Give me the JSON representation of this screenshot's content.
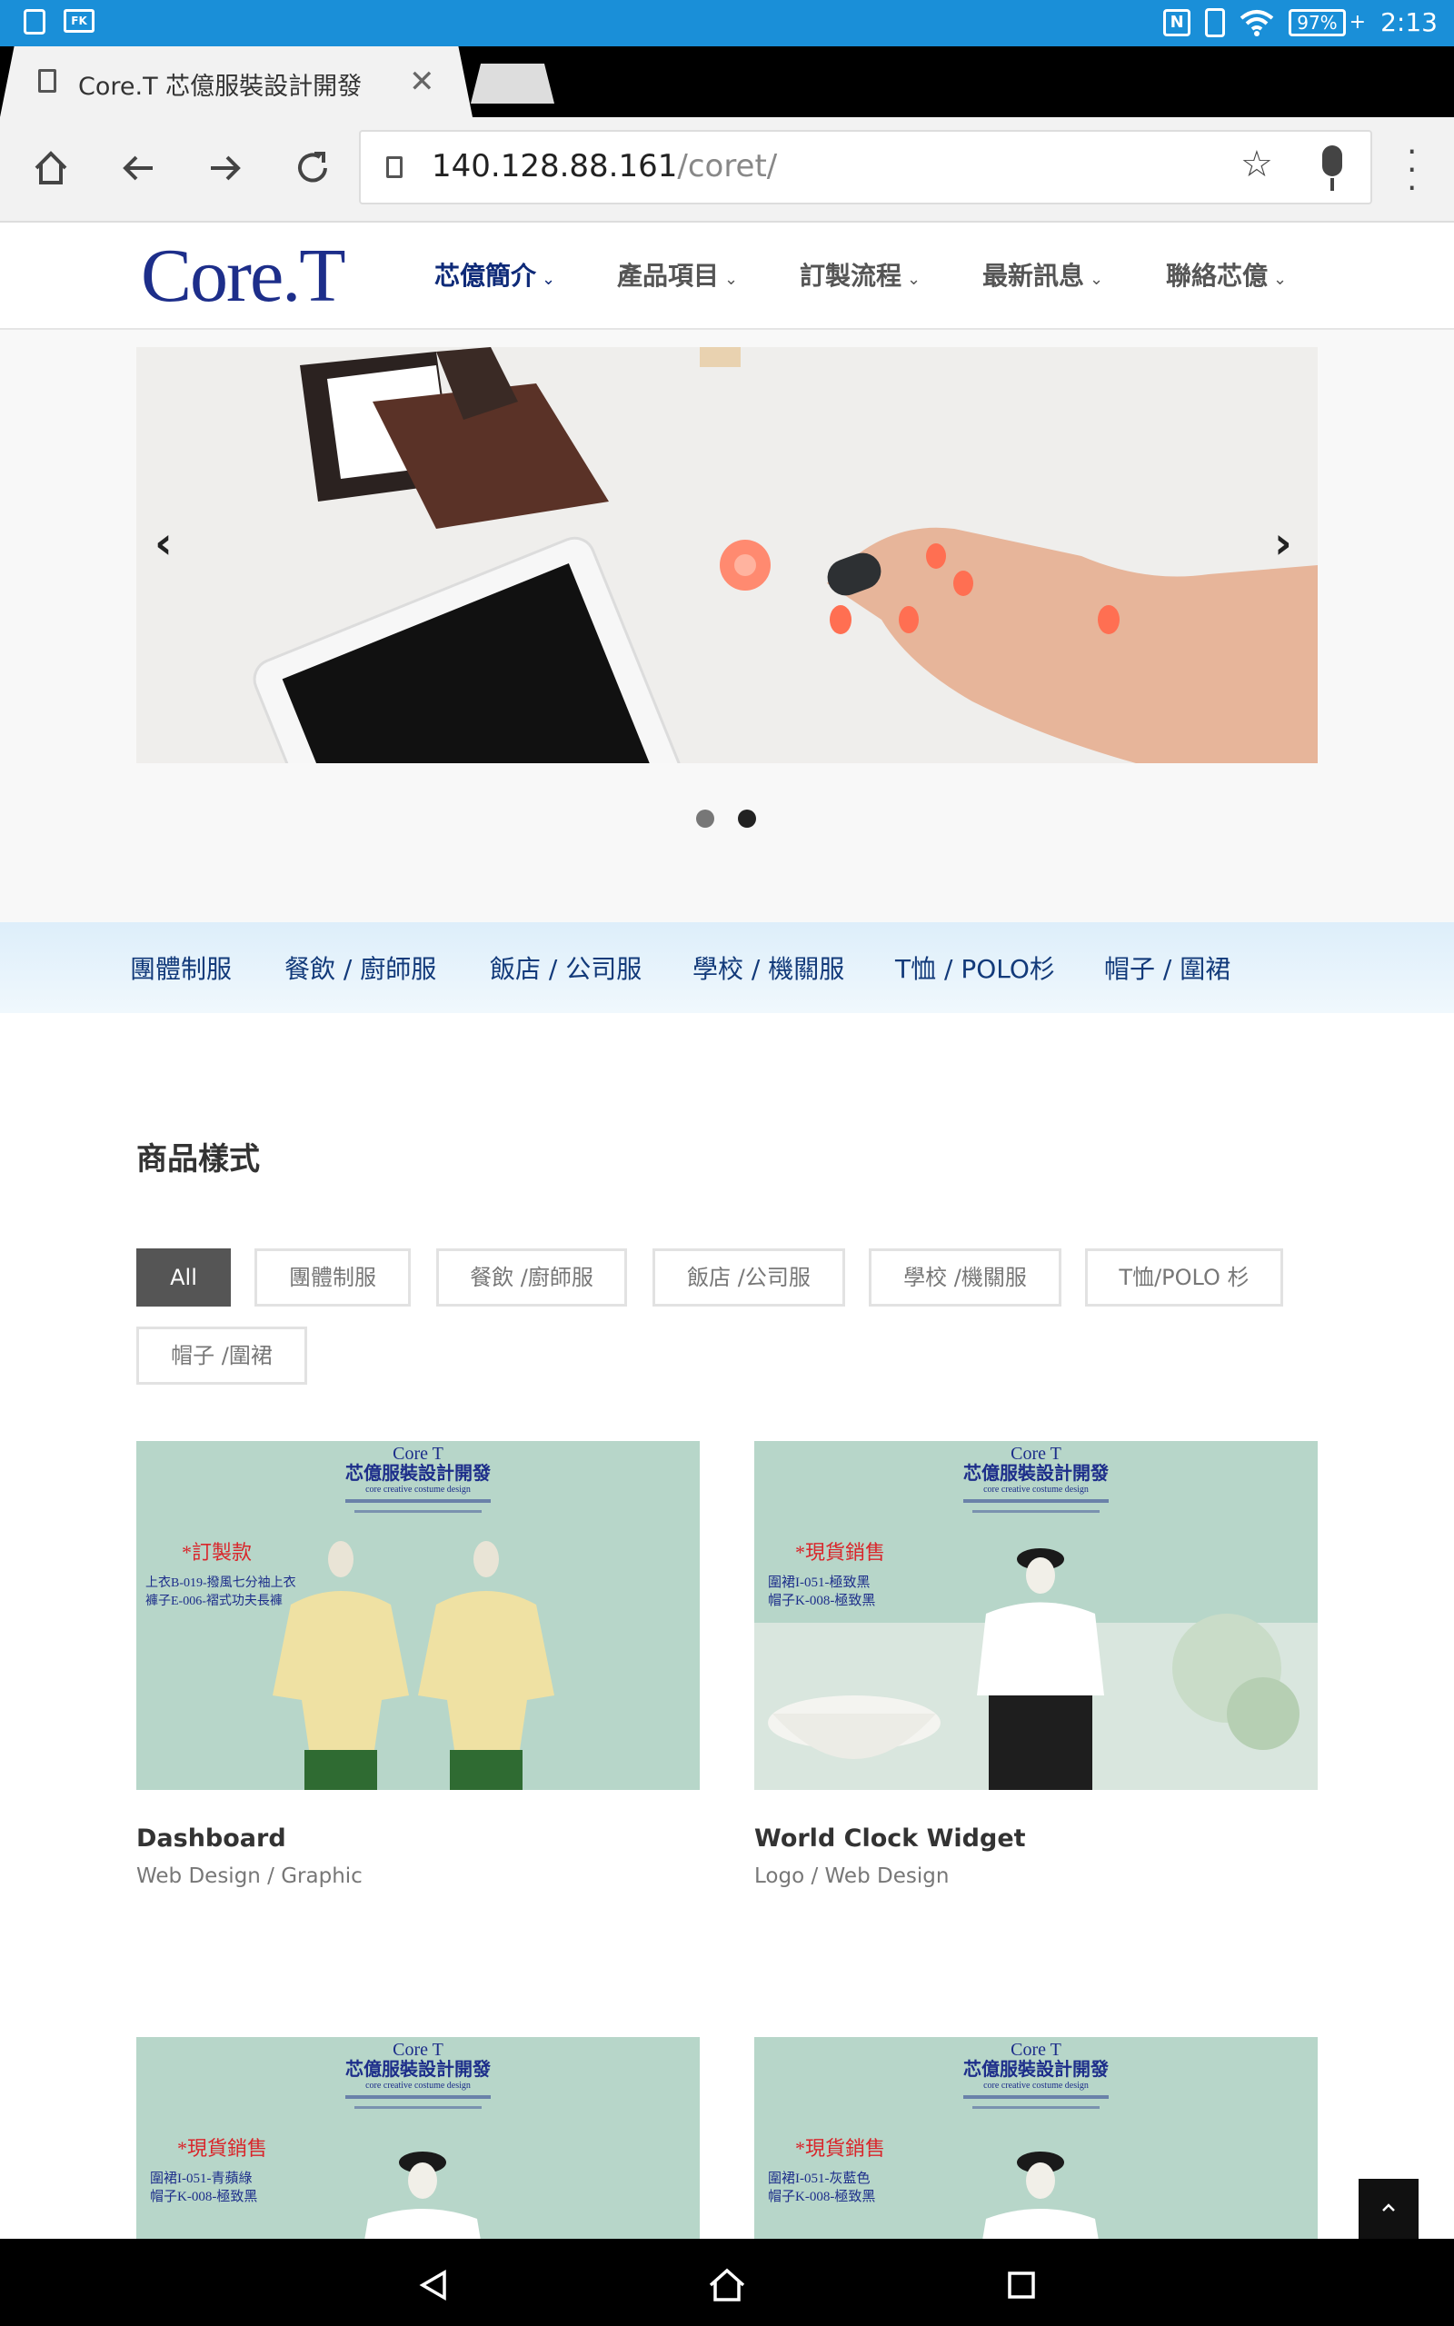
{
  "status_bar": {
    "time": "2:13",
    "battery": "97%",
    "icons": [
      "download-icon",
      "fk-icon",
      "nfc-icon",
      "vibrate-icon",
      "wifi-icon",
      "battery-icon"
    ]
  },
  "browser": {
    "tab_title": "Core.T 芯億服裝設計開發",
    "url_host": "140.128.88.161",
    "url_path": "/coret/"
  },
  "site": {
    "logo_text": "Core.T",
    "nav": [
      {
        "label": "芯億簡介"
      },
      {
        "label": "產品項目"
      },
      {
        "label": "訂製流程"
      },
      {
        "label": "最新訊息"
      },
      {
        "label": "聯絡芯億"
      }
    ]
  },
  "carousel": {
    "prev": "‹",
    "next": "›",
    "active_slide": 2,
    "slide_count": 2
  },
  "categories": [
    "團體制服",
    "餐飲 / 廚師服",
    "飯店 / 公司服",
    "學校 / 機關服",
    "T恤 / POLO杉",
    "帽子 / 圍裙"
  ],
  "products_section": {
    "title": "商品樣式",
    "filters": [
      "All",
      "團體制服",
      "餐飲 /廚師服",
      "飯店 /公司服",
      "學校 /機關服",
      "T恤/POLO 杉",
      "帽子 /圍裙"
    ]
  },
  "cards": [
    {
      "title": "Dashboard",
      "subtitle": "Web Design / Graphic",
      "img_brand": "Core T",
      "img_company": "芯億服裝設計開發",
      "img_tagline": "core creative costume design",
      "img_tag": "*訂製款",
      "img_lines": [
        "上衣B-019-撥風七分袖上衣",
        "褲子E-006-褶式功夫長褲"
      ]
    },
    {
      "title": "World Clock Widget",
      "subtitle": "Logo / Web Design",
      "img_brand": "Core T",
      "img_company": "芯億服裝設計開發",
      "img_tagline": "core creative costume design",
      "img_tag": "*現貨銷售",
      "img_lines": [
        "圍裙I-051-極致黑",
        "帽子K-008-極致黑"
      ]
    },
    {
      "img_brand": "Core T",
      "img_company": "芯億服裝設計開發",
      "img_tagline": "core creative costume design",
      "img_tag": "*現貨銷售",
      "img_lines": [
        "圍裙I-051-青蘋綠",
        "帽子K-008-極致黑"
      ]
    },
    {
      "img_brand": "Core T",
      "img_company": "芯億服裝設計開發",
      "img_tagline": "core creative costume design",
      "img_tag": "*現貨銷售",
      "img_lines": [
        "圍裙I-051-灰藍色",
        "帽子K-008-極致黑"
      ]
    }
  ],
  "colors": {
    "status_bar": "#1a8fd8",
    "brand_navy": "#1d2e8a",
    "category_text": "#123a7a",
    "card_bg": "#b9d8cb",
    "tag_red": "#d9262b"
  }
}
